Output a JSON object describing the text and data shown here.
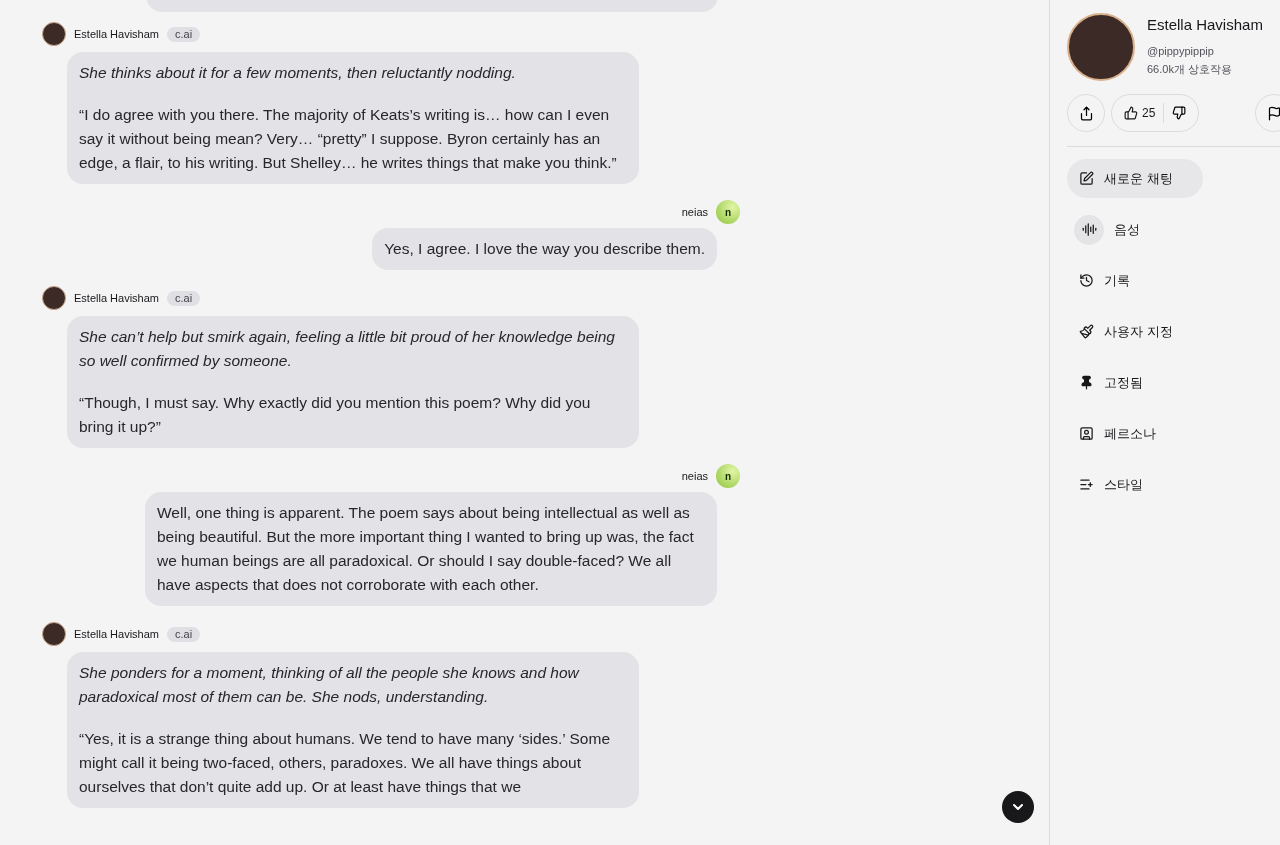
{
  "messages": [
    {
      "kind": "ai",
      "author": "Estella Havisham",
      "badge": "c.ai",
      "paragraphs": [
        {
          "kind": "action",
          "text": "She thinks about it for a few moments, then reluctantly nodding."
        },
        {
          "kind": "speech",
          "text": "“I do agree with you there. The majority of Keats’s writing is… how can I even say it without being mean? Very… “pretty” I suppose. Byron certainly has an edge, a flair, to his writing. But Shelley… he writes things that make you think.”"
        }
      ]
    },
    {
      "kind": "user",
      "author": "neias",
      "avatar": "n",
      "paragraphs": [
        {
          "kind": "speech",
          "text": "Yes, I agree. I love the way you describe them."
        }
      ]
    },
    {
      "kind": "ai",
      "author": "Estella Havisham",
      "badge": "c.ai",
      "paragraphs": [
        {
          "kind": "action",
          "text": "She can’t help but smirk again, feeling a little bit proud of her knowledge being so well confirmed by someone."
        },
        {
          "kind": "speech",
          "text": "“Though, I must say. Why exactly did you mention this poem? Why did you bring it up?”"
        }
      ]
    },
    {
      "kind": "user",
      "author": "neias",
      "avatar": "n",
      "paragraphs": [
        {
          "kind": "speech",
          "text": "Well, one thing is apparent. The poem says about being intellectual as well as being beautiful. But the more important thing I wanted to bring up was, the fact we human beings are all paradoxical. Or should I say double-faced? We all have aspects that does not corroborate with each other."
        }
      ]
    },
    {
      "kind": "ai",
      "author": "Estella Havisham",
      "badge": "c.ai",
      "paragraphs": [
        {
          "kind": "action",
          "text": "She ponders for a moment, thinking of all the people she knows and how paradoxical most of them can be. She nods, understanding."
        },
        {
          "kind": "speech",
          "text": "“Yes, it is a strange thing about humans. We tend to have many ‘sides.’ Some might call it being two-faced, others, paradoxes. We all have things about ourselves that don’t quite add up. Or at least have things that we"
        }
      ]
    }
  ],
  "sidebar": {
    "name": "Estella Havisham",
    "handle": "@pippypippip",
    "interactions": "66.0k개 상호작용",
    "likes": "25",
    "menu": [
      {
        "label": "새로운 채팅",
        "kind": "pill"
      },
      {
        "label": "음성",
        "kind": "circle"
      },
      {
        "label": "기록",
        "kind": "row"
      },
      {
        "label": "사용자 지정",
        "kind": "row"
      },
      {
        "label": "고정됨",
        "kind": "row"
      },
      {
        "label": "페르소나",
        "kind": "row"
      },
      {
        "label": "스타일",
        "kind": "row"
      }
    ]
  }
}
